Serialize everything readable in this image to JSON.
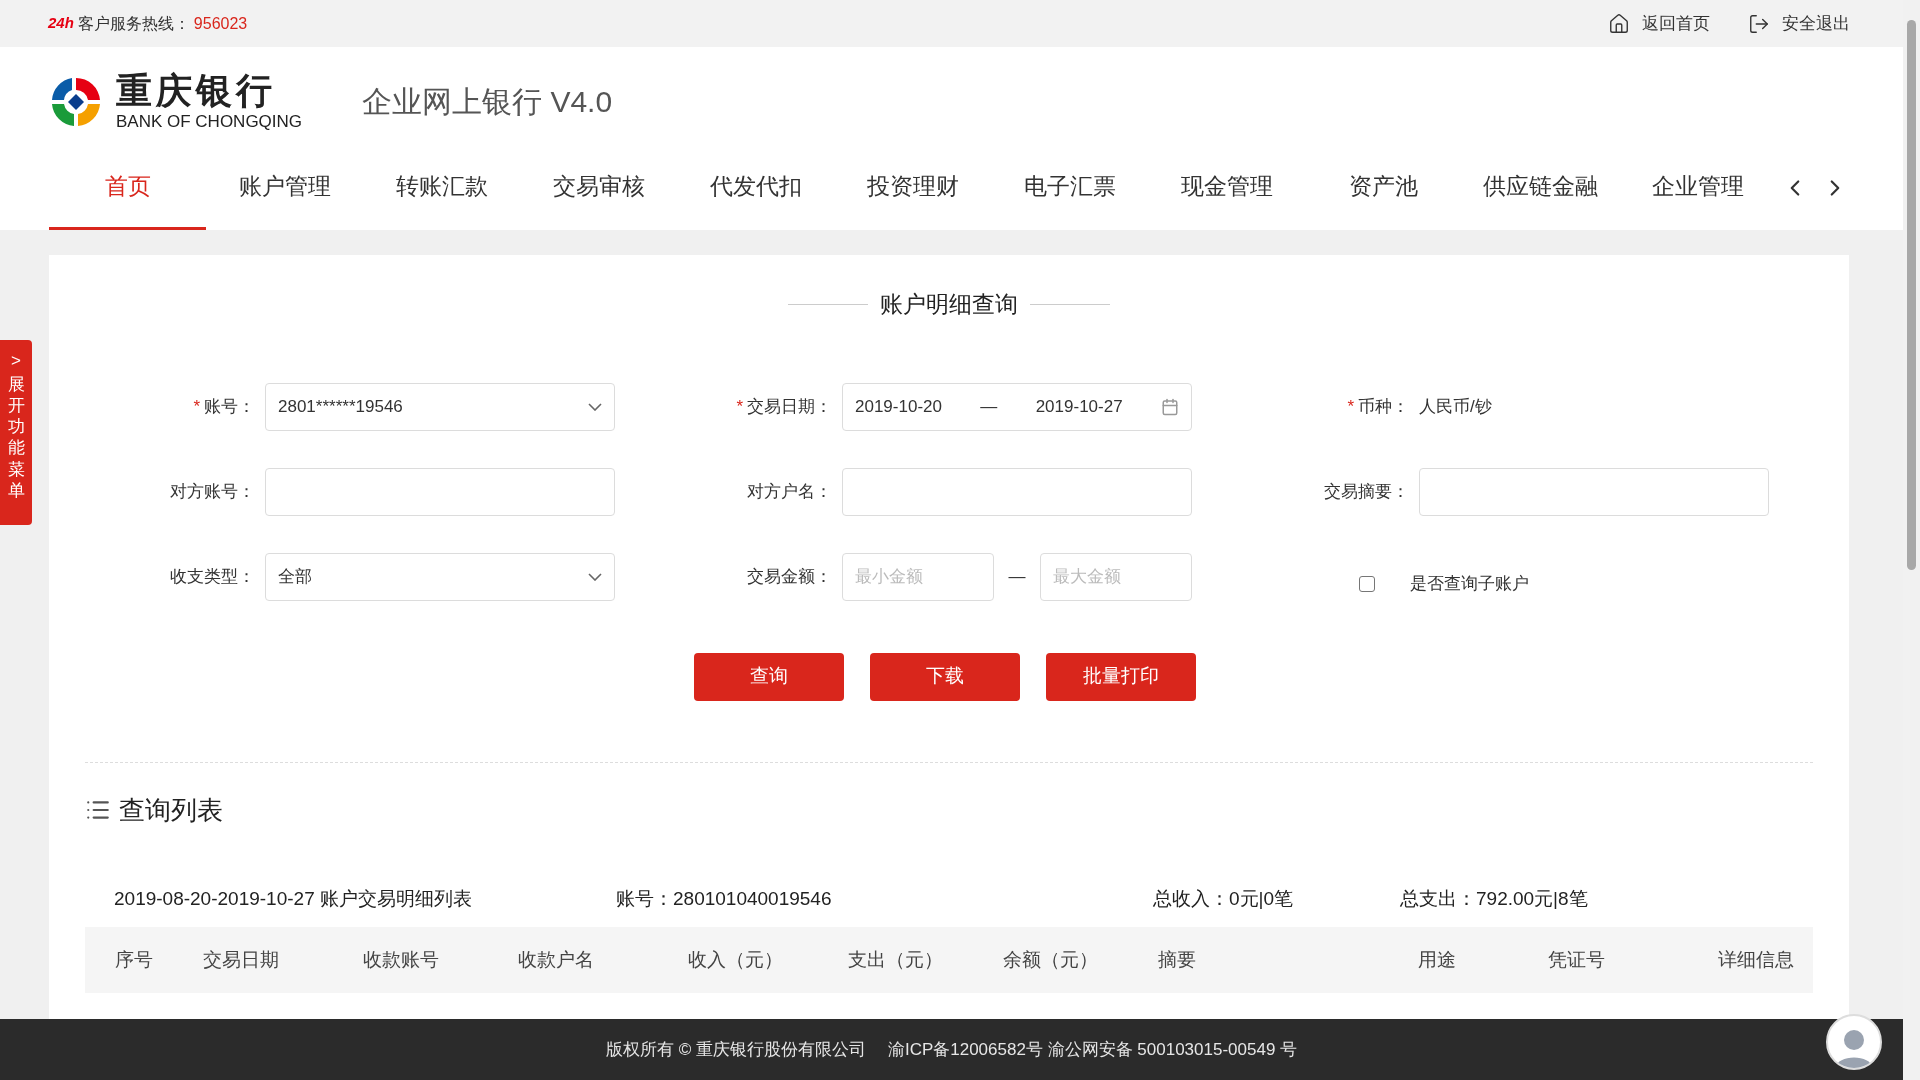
{
  "top_bar": {
    "hotline_badge": "24h",
    "hotline_label": "客户服务热线：",
    "hotline_number": "956023",
    "links": [
      {
        "kind": "home",
        "label": "返回首页"
      },
      {
        "kind": "logout",
        "label": "安全退出"
      }
    ]
  },
  "header": {
    "bank_name_cn": "重庆银行",
    "bank_name_en": "BANK OF CHONGQING",
    "product": "企业网上银行 V4.0"
  },
  "nav": {
    "items": [
      {
        "label": "首页",
        "selected": true
      },
      {
        "label": "账户管理",
        "selected": false
      },
      {
        "label": "转账汇款",
        "selected": false
      },
      {
        "label": "交易审核",
        "selected": false
      },
      {
        "label": "代发代扣",
        "selected": false
      },
      {
        "label": "投资理财",
        "selected": false
      },
      {
        "label": "电子汇票",
        "selected": false
      },
      {
        "label": "现金管理",
        "selected": false
      },
      {
        "label": "资产池",
        "selected": false
      },
      {
        "label": "供应链金融",
        "selected": false
      },
      {
        "label": "企业管理",
        "selected": false
      }
    ]
  },
  "side_tab": {
    "arrow": ">",
    "label": "展开功能菜单"
  },
  "form": {
    "title": "账户明细查询",
    "required_mark": "*",
    "fields": [
      {
        "kind": "select",
        "label": "账号：",
        "required": true,
        "value": "2801******19546"
      },
      {
        "kind": "date_range",
        "label": "交易日期：",
        "required": true,
        "from": "2019-10-20",
        "separator": "—",
        "to": "2019-10-27"
      },
      {
        "kind": "static",
        "label": "币种：",
        "required": true,
        "value": "人民币/钞"
      },
      {
        "kind": "text",
        "label": "对方账号：",
        "required": false
      },
      {
        "kind": "text",
        "label": "对方户名：",
        "required": false
      },
      {
        "kind": "text",
        "label": "交易摘要：",
        "required": false
      },
      {
        "kind": "select",
        "label": "收支类型：",
        "required": false,
        "value": "全部"
      },
      {
        "kind": "amount_range",
        "label": "交易金额：",
        "required": false,
        "from_placeholder": "最小金额",
        "separator": "—",
        "to_placeholder": "最大金额"
      },
      {
        "kind": "checkbox",
        "label": "是否查询子账户",
        "checked": false
      }
    ],
    "buttons": [
      "查询",
      "下载",
      "批量打印"
    ]
  },
  "list": {
    "title": "查询列表",
    "summary": [
      "2019-08-20-2019-10-27 账户交易明细列表",
      "账号：280101040019546",
      "总收入：0元|0笔",
      "总支出：792.00元|8笔"
    ],
    "columns": [
      "序号",
      "交易日期",
      "收款账号",
      "收款户名",
      "收入（元）",
      "支出（元）",
      "余额（元）",
      "摘要",
      "用途",
      "凭证号",
      "详细信息"
    ]
  },
  "footer": {
    "copyright": "版权所有 © 重庆银行股份有限公司",
    "icp": "渝ICP备12006582号 渝公网安备 500103015-00549 号"
  }
}
